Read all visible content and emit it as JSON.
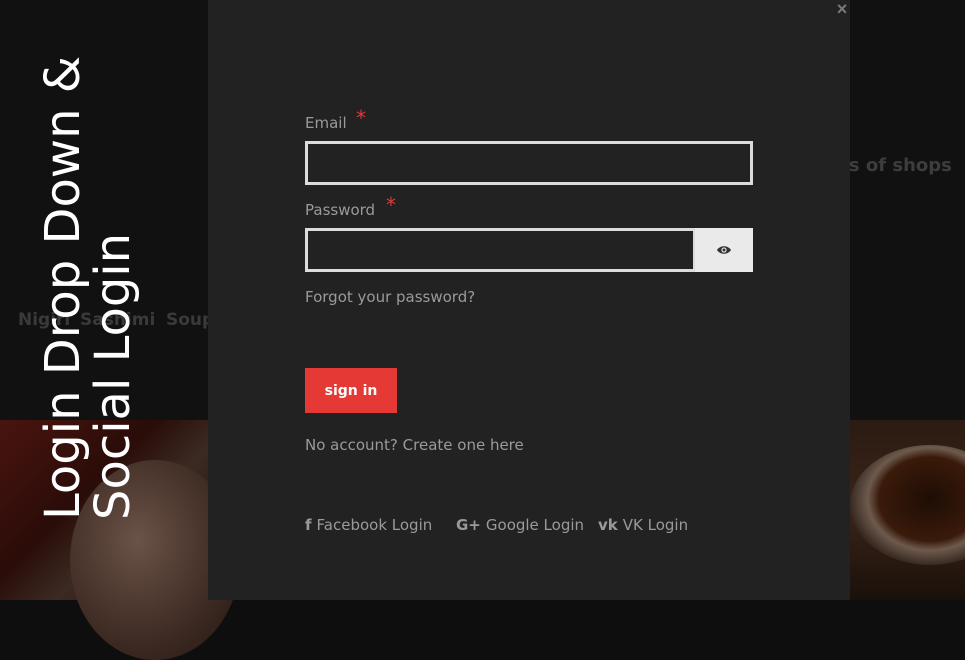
{
  "side_title": {
    "line1": "Login Drop Down &",
    "line2": "Social Login"
  },
  "background": {
    "nav_items": [
      "Nigiri",
      "Sashimi",
      "Soup"
    ],
    "promo_text": "ses of shops"
  },
  "modal": {
    "close_glyph": "×",
    "email": {
      "label": "Email",
      "required_mark": "*",
      "value": ""
    },
    "password": {
      "label": "Password",
      "required_mark": "*",
      "value": ""
    },
    "forgot_password": "Forgot your password?",
    "sign_in_label": "sign in",
    "no_account": "No account? Create one here",
    "social": [
      {
        "icon": "facebook-icon",
        "glyph": "f",
        "label": "Facebook Login"
      },
      {
        "icon": "google-plus-icon",
        "glyph": "G+",
        "label": "Google Login"
      },
      {
        "icon": "vk-icon",
        "glyph": "vk",
        "label": "VK Login"
      }
    ]
  },
  "colors": {
    "accent": "#e53935",
    "modal_bg": "#222222",
    "text_muted": "#9a9a9a",
    "input_border": "#dcdcdc"
  }
}
